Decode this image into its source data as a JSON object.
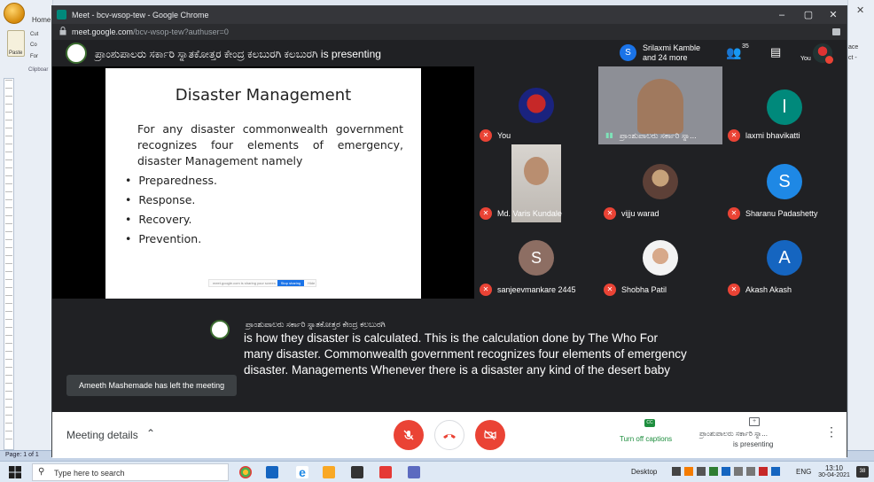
{
  "word": {
    "home_tab": "Home",
    "paste_label": "Paste",
    "cut_label": "Cut",
    "copy_label": "Co",
    "format_label": "For",
    "clipboard_label": "Clipboar",
    "right_text1": "ace",
    "right_text2": "ct -",
    "page_status": "Page: 1 of 1"
  },
  "chrome": {
    "title": "Meet - bcv-wsop-tew - Google Chrome",
    "url_host": "meet.google.com",
    "url_path": "/bcv-wsop-tew?authuser=0"
  },
  "meet": {
    "presenter_name": "ಪ್ರಾಂಶುಪಾಲರು ಸರ್ಕಾರಿ ಸ್ನಾತಕೋತ್ತರ ಕೇಂದ್ರ ಕಲಬುರಗಿ ಕಲಬುರಗಿ",
    "presenting_suffix": "is presenting",
    "summary_initial": "S",
    "summary_line1": "Srilaxmi Kamble",
    "summary_line2": "and 24 more",
    "people_count": "35",
    "you_label": "You",
    "slide": {
      "title": "Disaster Management",
      "intro": "For any disaster commonwealth government recognizes four elements of emergency, disaster Management namely",
      "bullets": [
        "Preparedness.",
        "Response.",
        "Recovery.",
        "Prevention."
      ],
      "share_notice": "meet.google.com is sharing your screen.",
      "stop_sharing": "Stop sharing",
      "hide": "Hide"
    },
    "tiles": [
      {
        "name": "You"
      },
      {
        "name": "ಪ್ರಾಂಶುಪಾಲರು ಸರ್ಕಾರಿ ಸ್ನಾ..."
      },
      {
        "name": "laxmi bhavikatti",
        "initial": "l"
      },
      {
        "name": "Md. Varis Kundale"
      },
      {
        "name": "vijju warad"
      },
      {
        "name": "Sharanu Padashetty",
        "initial": "S"
      },
      {
        "name": "sanjeevmankare 2445",
        "initial": "S"
      },
      {
        "name": "Shobha Patil"
      },
      {
        "name": "Akash Akash",
        "initial": "A"
      }
    ],
    "caption_speaker": "ಪ್ರಾಂಶುಪಾಲರು ಸರ್ಕಾರಿ ಸ್ನಾತಕೋತ್ತರ ಕೇಂದ್ರ ಕಲಬುರಗಿ",
    "caption_text": "is how they disaster is calculated. This is the calculation done by The Who For many disaster. Commonwealth government recognizes four elements of emergency disaster. Managements Whenever there is a disaster any kind of the desert baby",
    "toast": "Ameeth Mashemade has left the meeting",
    "meeting_details": "Meeting details",
    "cc_badge": "CC",
    "turn_off_captions": "Turn off captions",
    "presenting_name": "ಪ್ರಾಂಶುಪಾಲರು ಸರ್ಕಾರಿ ಸ್ನಾ...",
    "presenting_label": "is presenting"
  },
  "taskbar": {
    "search_placeholder": "Type here to search",
    "desktop_label": "Desktop",
    "lang": "ENG",
    "time": "13:10",
    "date": "30-04-2021",
    "notif_count": "38"
  },
  "colors": {
    "meet_bg": "#202124",
    "tile_bg": "#3c4043",
    "mute_red": "#ea4335",
    "blue": "#1a73e8",
    "teal": "#00897b",
    "caption_green": "#1e8e3e"
  }
}
